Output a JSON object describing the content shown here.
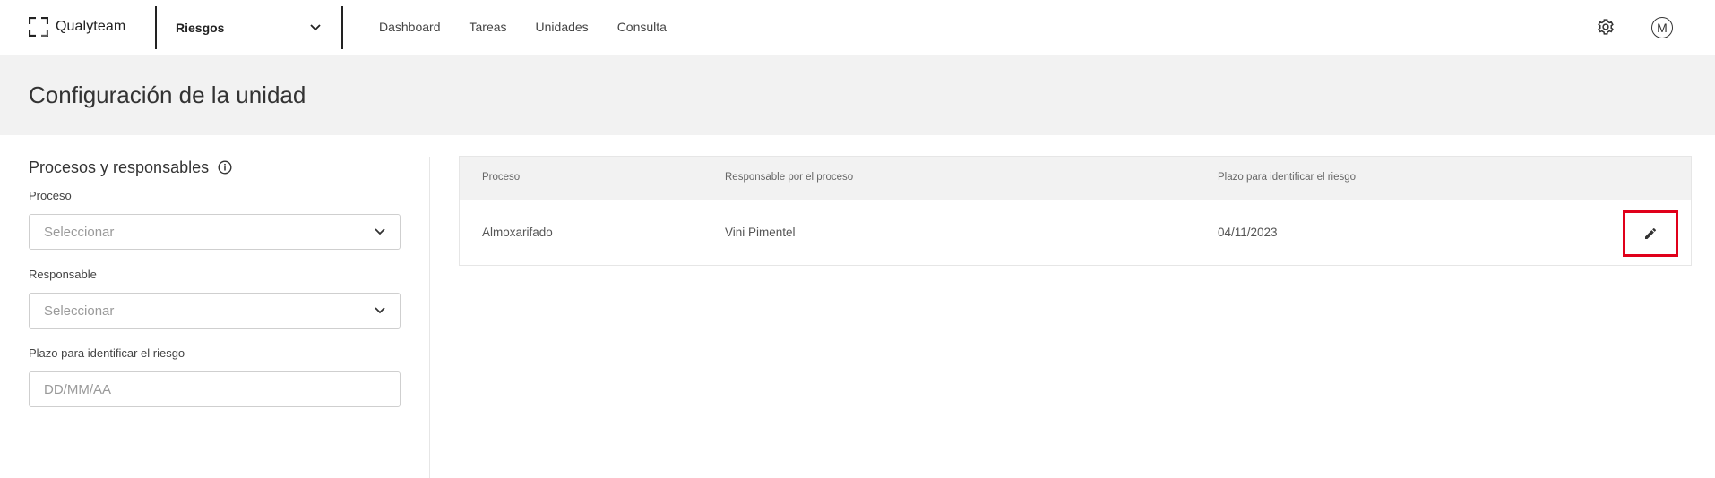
{
  "brand": {
    "name": "Qualyteam"
  },
  "module": {
    "label": "Riesgos"
  },
  "nav": {
    "items": [
      "Dashboard",
      "Tareas",
      "Unidades",
      "Consulta"
    ]
  },
  "user": {
    "initial": "M"
  },
  "page": {
    "title": "Configuración de la unidad"
  },
  "form": {
    "section_title": "Procesos y responsables",
    "proceso": {
      "label": "Proceso",
      "placeholder": "Seleccionar"
    },
    "responsable": {
      "label": "Responsable",
      "placeholder": "Seleccionar"
    },
    "plazo": {
      "label": "Plazo para identificar el riesgo",
      "placeholder": "DD/MM/AA"
    }
  },
  "table": {
    "columns": [
      "Proceso",
      "Responsable por el proceso",
      "Plazo para identificar el riesgo"
    ],
    "rows": [
      {
        "proceso": "Almoxarifado",
        "responsable": "Vini Pimentel",
        "plazo": "04/11/2023"
      }
    ]
  },
  "colors": {
    "highlight": "#e0001a",
    "header_bg": "#f2f2f2"
  }
}
